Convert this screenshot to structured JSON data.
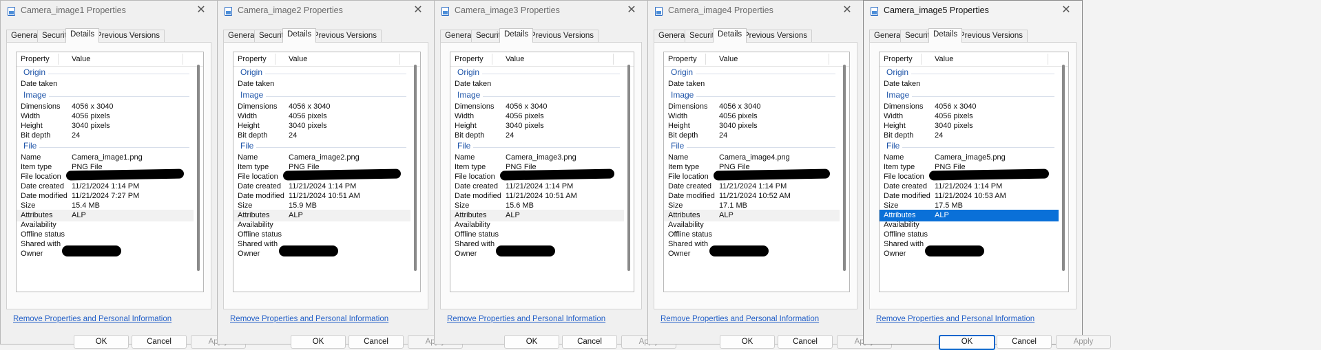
{
  "dialogs": [
    {
      "title": "Camera_image1 Properties",
      "active": false,
      "name": "Camera_image1.png",
      "date_modified": "11/21/2024 7:27 PM",
      "size": "15.4 MB",
      "attr_highlight": "shade"
    },
    {
      "title": "Camera_image2 Properties",
      "active": false,
      "name": "Camera_image2.png",
      "date_modified": "11/21/2024 10:51 AM",
      "size": "15.9 MB",
      "attr_highlight": "shade"
    },
    {
      "title": "Camera_image3 Properties",
      "active": false,
      "name": "Camera_image3.png",
      "date_modified": "11/21/2024 10:51 AM",
      "size": "15.6 MB",
      "attr_highlight": "shade"
    },
    {
      "title": "Camera_image4 Properties",
      "active": false,
      "name": "Camera_image4.png",
      "date_modified": "11/21/2024 10:52 AM",
      "size": "17.1 MB",
      "attr_highlight": "shade"
    },
    {
      "title": "Camera_image5 Properties",
      "active": true,
      "name": "Camera_image5.png",
      "date_modified": "11/21/2024 10:53 AM",
      "size": "17.5 MB",
      "attr_highlight": "hl"
    }
  ],
  "tabs": [
    "General",
    "Security",
    "Details",
    "Previous Versions"
  ],
  "selected_tab": "Details",
  "list_headers": {
    "property": "Property",
    "value": "Value"
  },
  "groups": {
    "origin": "Origin",
    "image": "Image",
    "file": "File"
  },
  "labels": {
    "date_taken": "Date taken",
    "dimensions": "Dimensions",
    "width": "Width",
    "height": "Height",
    "bit_depth": "Bit depth",
    "name": "Name",
    "item_type": "Item type",
    "file_location": "File location",
    "date_created": "Date created",
    "date_modified": "Date modified",
    "size": "Size",
    "attributes": "Attributes",
    "availability": "Availability",
    "offline_status": "Offline status",
    "shared_with": "Shared with",
    "owner": "Owner"
  },
  "common_values": {
    "dimensions": "4056 x 3040",
    "width": "4056 pixels",
    "height": "3040 pixels",
    "bit_depth": "24",
    "item_type": "PNG File",
    "date_created": "11/21/2024 1:14 PM",
    "attributes": "ALP"
  },
  "link_text": "Remove Properties and Personal Information",
  "buttons": {
    "ok": "OK",
    "cancel": "Cancel",
    "apply": "Apply"
  },
  "close_glyph": "✕",
  "colors": {
    "accent": "#0a70d8",
    "group": "#1f55a9",
    "link": "#2561c8"
  }
}
